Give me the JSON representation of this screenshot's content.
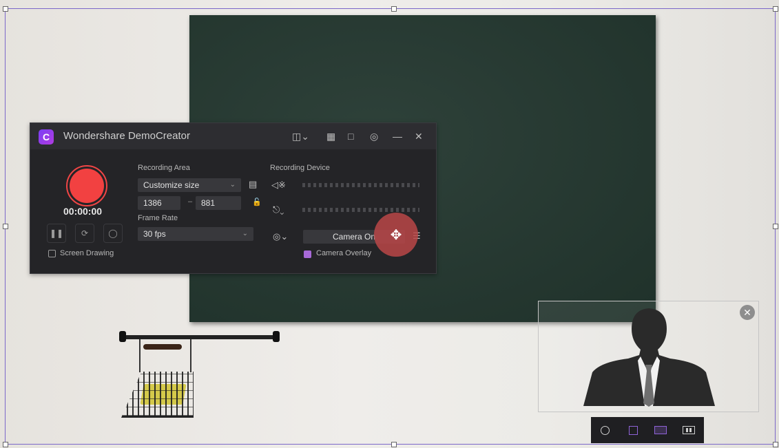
{
  "app": {
    "title": "Wondershare DemoCreator",
    "logo_glyph": "C"
  },
  "titlebar_icons": [
    "screen-select-icon",
    "record-window-icon",
    "fullscreen-icon",
    "settings-icon",
    "minimize-icon",
    "close-icon"
  ],
  "recorder": {
    "timer": "00:00:00",
    "screen_drawing_label": "Screen Drawing",
    "recording_area": {
      "label": "Recording Area",
      "mode": "Customize size",
      "width": "1386",
      "dash": "–",
      "height": "881"
    },
    "frame_rate": {
      "label": "Frame Rate",
      "value": "30 fps"
    },
    "recording_device": {
      "label": "Recording Device",
      "camera_value": "Camera On",
      "camera_overlay_label": "Camera Overlay",
      "camera_overlay_checked": true
    }
  },
  "colors": {
    "accent": "#a86ad8",
    "record": "#f24141",
    "move_handle": "#ba4648"
  },
  "camera_shapes": [
    "circle-shape-icon",
    "square-shape-icon",
    "picture-shape-icon",
    "split-shape-icon"
  ]
}
